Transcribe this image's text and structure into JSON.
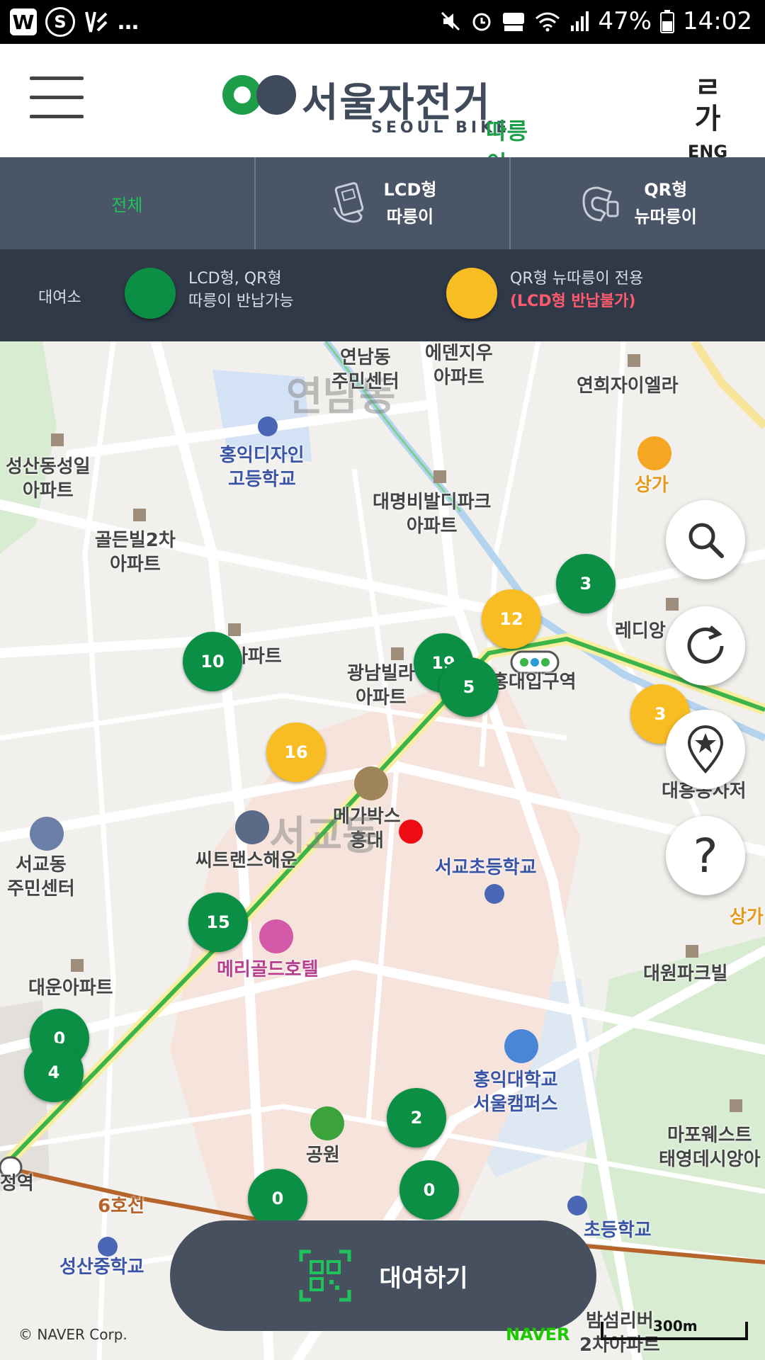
{
  "status_bar": {
    "left_badges": [
      "W",
      "S",
      "…"
    ],
    "battery": "47%",
    "time": "14:02",
    "icons": [
      "mute-icon",
      "alarm-icon",
      "hd-voice-icon",
      "wifi-icon",
      "signal-icon",
      "battery-icon"
    ]
  },
  "header": {
    "logo_kor": "서울자전거",
    "logo_eng": "SEOUL BIKE",
    "logo_brand": "따릉이",
    "lang_glyph": "ㄹ가",
    "lang_label": "ENG"
  },
  "tabs": [
    {
      "label": "전체"
    },
    {
      "line1": "LCD형",
      "line2": "따릉이"
    },
    {
      "line1": "QR형",
      "line2": "뉴따릉이"
    }
  ],
  "legend": {
    "title": "대여소",
    "green_line1": "LCD형, QR형",
    "green_line2": "따릉이 반납가능",
    "yellow_line1": "QR형 뉴따릉이 전용",
    "yellow_line2": "(LCD형 반납불가)"
  },
  "colors": {
    "green_station": "#0b8f45",
    "yellow_station": "#f8bd22",
    "header_tab_bg": "#4a5567",
    "legend_bg": "#2f3948",
    "active_tab": "#1fc35b"
  },
  "map": {
    "labels": {
      "yeonnam_center": "연남동\n주민센터",
      "edenview": "에덴지우\n아파트",
      "yeonhui": "연희자이엘라",
      "yeonnamdong": "연남동",
      "hongik_design": "홍익디자인\n고등학교",
      "seongsan": "성산동성일\n아파트",
      "goldenville": "골든빌2차\n아파트",
      "daemyung": "대명비발디파크\n아파트",
      "sangga1": "상가",
      "gwangnam": "광남빌라\n아파트",
      "hongik_station": "홍대입구역",
      "apt_partial": "아파트",
      "megabox": "메가박스\n홍대",
      "citrans": "씨트랜스해운",
      "seogyodong_big": "서교동",
      "seogyo_elem": "서교초등학교",
      "seogyo_center": "서교동\n주민센터",
      "merigold": "메리골드호텔",
      "daewoon": "대운아파트",
      "daewon": "대원파크빌",
      "hongik_univ": "홍익대학교\n서울캠퍼스",
      "mapo_west": "마포웨스트\n태영데시앙아",
      "park": "공원",
      "line6": "6호선",
      "station_left": "정역",
      "seongsan_middle": "성산중학교",
      "school_bottom": "초등학교",
      "bamseom": "밤섬리버\n2차아파트",
      "daeheung": "대흥동사저",
      "readings": "레디앙",
      "sangga2": "상가"
    },
    "clusters": [
      {
        "value": "3",
        "color": "green"
      },
      {
        "value": "12",
        "color": "yellow"
      },
      {
        "value": "10",
        "color": "green"
      },
      {
        "value": "19",
        "color": "green"
      },
      {
        "value": "5",
        "color": "green"
      },
      {
        "value": "3",
        "color": "yellow"
      },
      {
        "value": "16",
        "color": "yellow"
      },
      {
        "value": "15",
        "color": "green"
      },
      {
        "value": "0",
        "color": "green"
      },
      {
        "value": "4",
        "color": "green"
      },
      {
        "value": "2",
        "color": "green"
      },
      {
        "value": "0",
        "color": "green"
      },
      {
        "value": "0",
        "color": "green"
      }
    ],
    "fab_icons": [
      "search-icon",
      "refresh-icon",
      "favorite-pin-icon",
      "help-icon"
    ],
    "help_glyph": "?",
    "copyright": "© NAVER Corp.",
    "naver_logo": "NAVER",
    "scale_label": "300m"
  },
  "rent_button": {
    "label": "대여하기",
    "icon": "qr-scan-icon"
  }
}
